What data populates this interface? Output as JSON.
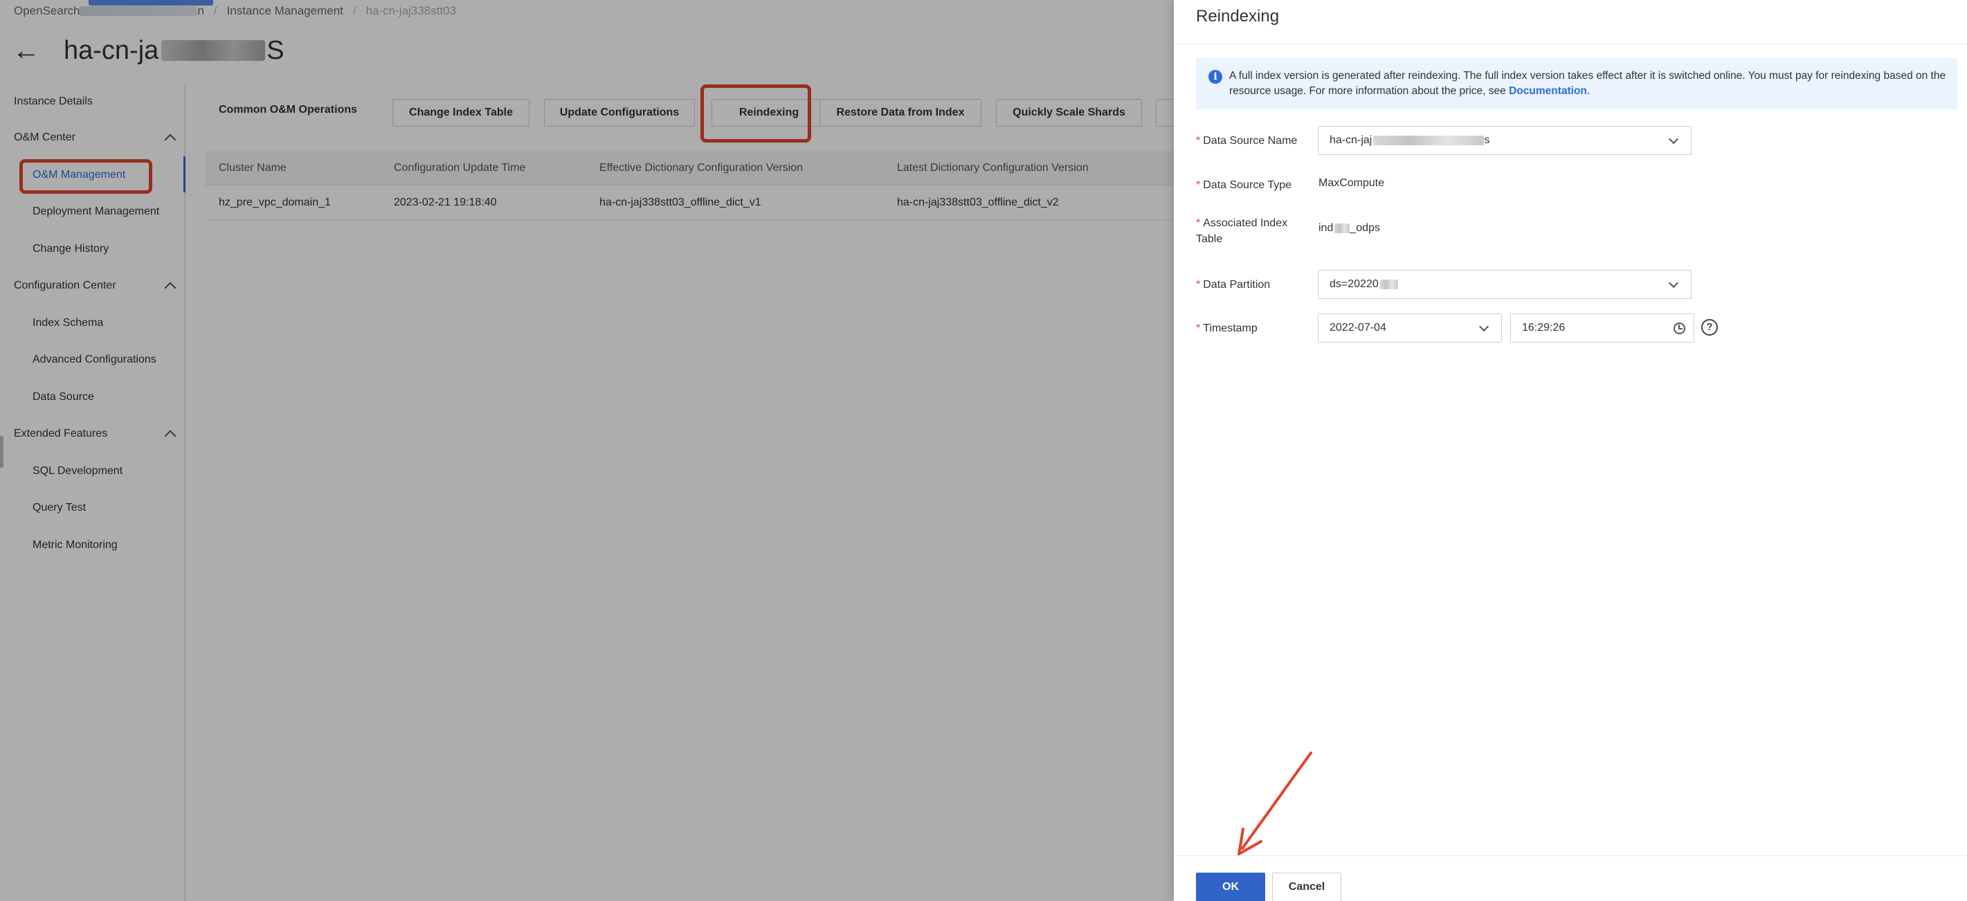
{
  "breadcrumb": {
    "item1": "OpenSearch",
    "item1_tail": "n",
    "item2": "Instance Management",
    "item3": "ha-cn-jaj338stt03"
  },
  "instance": {
    "title_prefix": "ha-cn-ja",
    "title_suffix": "S"
  },
  "sidebar": {
    "instance_details": "Instance Details",
    "om_center": "O&M Center",
    "om_management": "O&M Management",
    "deployment_management": "Deployment Management",
    "change_history": "Change History",
    "configuration_center": "Configuration Center",
    "index_schema": "Index Schema",
    "advanced_configurations": "Advanced Configurations",
    "data_source": "Data Source",
    "extended_features": "Extended Features",
    "sql_development": "SQL Development",
    "query_test": "Query Test",
    "metric_monitoring": "Metric Monitoring"
  },
  "operations": {
    "label": "Common O&M Operations",
    "buttons": [
      "Change Index Table",
      "Update Configurations",
      "Reindexing",
      "Restore Data from Index",
      "Quickly Scale Shards"
    ]
  },
  "table": {
    "headers": [
      "Cluster Name",
      "Configuration Update Time",
      "Effective Dictionary Configuration Version",
      "Latest Dictionary Configuration Version"
    ],
    "rows": [
      [
        "hz_pre_vpc_domain_1",
        "2023-02-21 19:18:40",
        "ha-cn-jaj338stt03_offline_dict_v1",
        "ha-cn-jaj338stt03_offline_dict_v2"
      ]
    ]
  },
  "drawer": {
    "title": "Reindexing",
    "info_text": "A full index version is generated after reindexing. The full index version takes effect after it is switched online. You must pay for reindexing based on the resource usage. For more information about the price, see ",
    "info_link": "Documentation",
    "info_end": ".",
    "fields": {
      "data_source_name": {
        "label": "Data Source Name",
        "value_prefix": "ha-cn-jaj",
        "value_suffix": "s"
      },
      "data_source_type": {
        "label": "Data Source Type",
        "value": "MaxCompute"
      },
      "associated_index_table": {
        "label": "Associated Index Table",
        "value_prefix": "ind",
        "value_suffix": "_odps"
      },
      "data_partition": {
        "label": "Data Partition",
        "value_prefix": "ds=20220"
      },
      "timestamp": {
        "label": "Timestamp",
        "date": "2022-07-04",
        "time": "16:29:26"
      }
    },
    "ok_label": "OK",
    "cancel_label": "Cancel"
  },
  "colors": {
    "accent": "#2f6bd9",
    "highlight": "#e0452c",
    "ok_button": "#2f63c8"
  },
  "icons": [
    "back-arrow-icon",
    "chevron-up-icon",
    "info-icon",
    "chevron-down-icon",
    "clock-icon",
    "help-icon",
    "annotation-arrow"
  ]
}
